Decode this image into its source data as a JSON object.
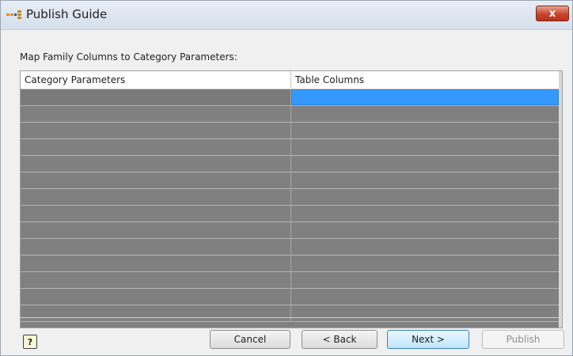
{
  "window": {
    "title": "Publish Guide",
    "close_label": "x"
  },
  "main": {
    "map_label": "Map Family Columns to Category Parameters:",
    "table": {
      "columns": [
        "Category Parameters",
        "Table Columns"
      ],
      "rows": [
        [
          "",
          ""
        ],
        [
          "",
          ""
        ],
        [
          "",
          ""
        ],
        [
          "",
          ""
        ],
        [
          "",
          ""
        ],
        [
          "",
          ""
        ],
        [
          "",
          ""
        ],
        [
          "",
          ""
        ],
        [
          "",
          ""
        ],
        [
          "",
          ""
        ],
        [
          "",
          ""
        ],
        [
          "",
          ""
        ],
        [
          "",
          ""
        ],
        [
          "",
          ""
        ]
      ],
      "selected_row": 0,
      "selected_column": 1
    }
  },
  "footer": {
    "help_label": "?",
    "cancel_label": "Cancel",
    "back_label": "< Back",
    "next_label": "Next >",
    "publish_label": "Publish"
  },
  "colors": {
    "selection": "#3399ff",
    "grid_fill": "#808080",
    "close_button": "#c9442d"
  },
  "icons": {
    "title_icon": "publish-guide-icon",
    "help_icon": "help-icon"
  }
}
